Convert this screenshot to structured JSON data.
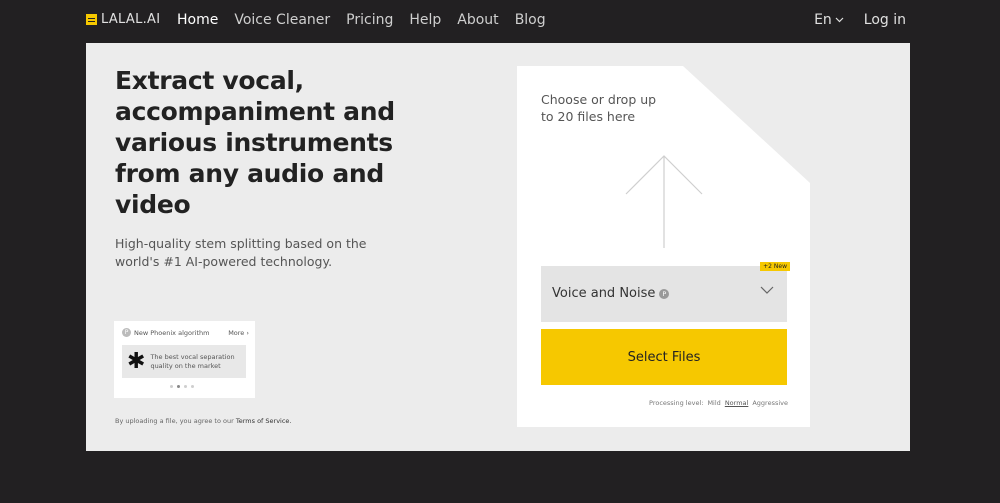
{
  "brand": {
    "name": "LALAL.AI"
  },
  "nav": {
    "links": [
      "Home",
      "Voice Cleaner",
      "Pricing",
      "Help",
      "About",
      "Blog"
    ],
    "language": "En",
    "login": "Log in"
  },
  "hero": {
    "title": "Extract vocal, accompaniment and various instruments from any audio and video",
    "subtitle": "High-quality stem splitting based on the world's #1 AI-powered technology."
  },
  "promo": {
    "badge": "New Phoenix algorithm",
    "more": "More",
    "card_text": "The best vocal separation quality on the market",
    "slides_total": 4,
    "slide_active": 2
  },
  "terms": {
    "prefix": "By uploading a file, you agree to our",
    "link": "Terms of Service."
  },
  "upload": {
    "drop_text": "Choose or drop up to 20 files here",
    "stem_select": {
      "value": "Voice and Noise",
      "badge": "+2 New"
    },
    "select_button": "Select Files",
    "processing": {
      "label": "Processing level:",
      "options": [
        "Mild",
        "Normal",
        "Aggressive"
      ],
      "selected": "Normal"
    }
  },
  "colors": {
    "accent": "#f6c800",
    "background": "#222022",
    "panel": "#ececec"
  }
}
